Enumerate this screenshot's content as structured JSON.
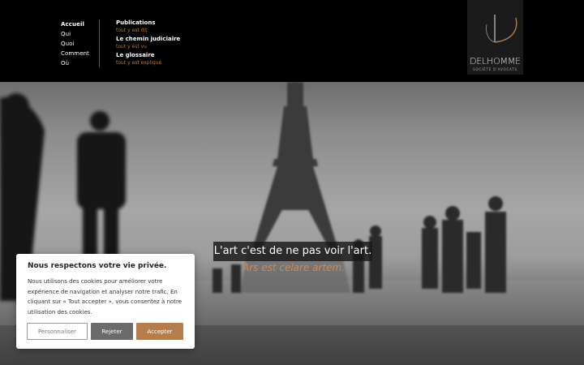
{
  "nav": {
    "main": [
      {
        "label": "Accueil",
        "active": true
      },
      {
        "label": "Qui"
      },
      {
        "label": "Quoi"
      },
      {
        "label": "Comment"
      },
      {
        "label": "Où"
      }
    ],
    "secondary": [
      {
        "title": "Publications",
        "subtitle": "tout y est dit"
      },
      {
        "title": "Le chemin judiciaire",
        "subtitle": "tout y est vu"
      },
      {
        "title": "Le glossaire",
        "subtitle": "tout y est expliqué"
      }
    ]
  },
  "logo": {
    "name": "DELHOMME",
    "subtitle": "SOCIÉTÉ D'AVOCATS"
  },
  "hero": {
    "quote": "L'art c'est de ne pas voir l'art.",
    "latin": "Ars est celare artem."
  },
  "cookie": {
    "title": "Nous respectons votre vie privée.",
    "text": "Nous utilisons des cookies pour améliorer votre expérience de navigation et analyser notre trafic. En cliquant sur « Tout accepter », vous consentez à notre utilisation des cookies.",
    "customize": "Personnaliser",
    "reject": "Rejeter",
    "accept": "Accepter"
  },
  "colors": {
    "accent": "#b57d4c",
    "reject": "#6b6b6b",
    "header_bg": "#000000"
  }
}
